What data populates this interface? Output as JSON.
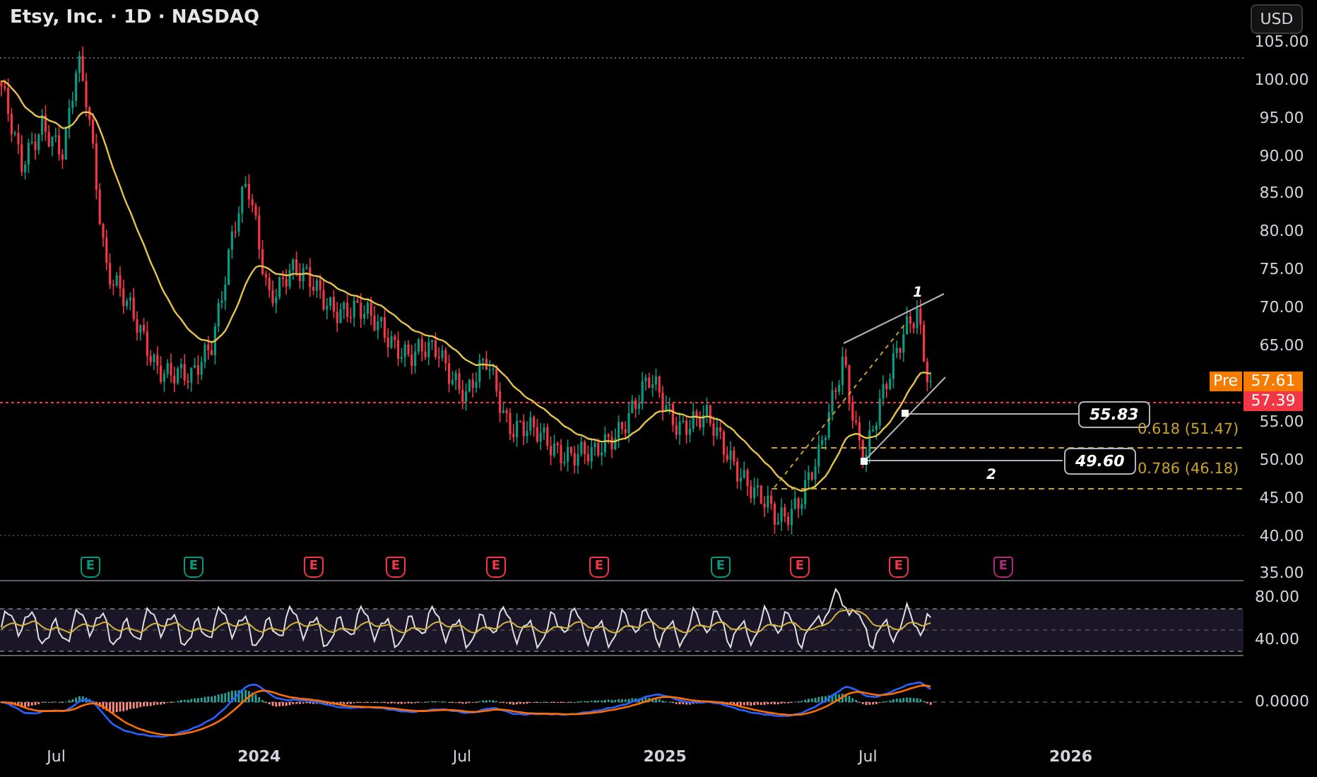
{
  "header": {
    "title": "Etsy, Inc. · 1D · NASDAQ",
    "currency": "USD"
  },
  "price_axis_upper": [
    "105.00",
    "100.00",
    "95.00",
    "90.00",
    "85.00",
    "80.00",
    "75.00",
    "70.00",
    "65.00"
  ],
  "price_axis_lower": [
    "55.00",
    "50.00",
    "45.00",
    "40.00",
    "35.00"
  ],
  "price_tags": [
    {
      "kind": "pre",
      "label": "Pre",
      "value": "57.61"
    },
    {
      "kind": "last",
      "value": "57.39"
    }
  ],
  "annotations": {
    "wave_labels": [
      "1",
      "2"
    ],
    "price_boxes": [
      "55.83",
      "49.60"
    ],
    "fib_levels": [
      "0.618 (51.47)",
      "0.786 (46.18)"
    ]
  },
  "earnings": [
    {
      "label": "E",
      "color": "#089981"
    },
    {
      "label": "E",
      "color": "#089981"
    },
    {
      "label": "E",
      "color": "#f23645"
    },
    {
      "label": "E",
      "color": "#f23645"
    },
    {
      "label": "E",
      "color": "#f23645"
    },
    {
      "label": "E",
      "color": "#f23645"
    },
    {
      "label": "E",
      "color": "#089981"
    },
    {
      "label": "E",
      "color": "#f23645"
    },
    {
      "label": "E",
      "color": "#f23645"
    },
    {
      "label": "E",
      "color": "#b02a7a"
    }
  ],
  "rsi_axis": [
    "80.00",
    "40.00"
  ],
  "macd_axis": [
    "0.0000"
  ],
  "time_axis": [
    "Jul",
    "2024",
    "Jul",
    "2025",
    "Jul",
    "2026"
  ]
}
